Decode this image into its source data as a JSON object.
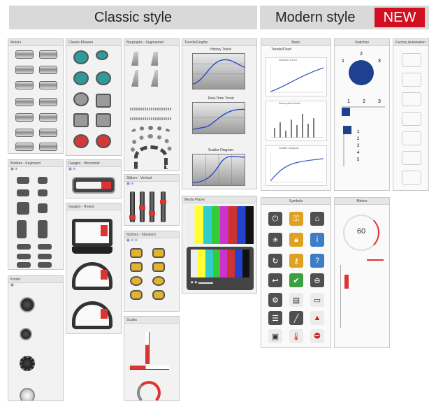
{
  "headers": {
    "classic": "Classic style",
    "modern": "Modern style",
    "new_badge": "NEW"
  },
  "panels": {
    "motors": "Motors",
    "blowers": "Classic Blowers",
    "bargraphs": "Bargraphs - Segmented",
    "trends": "Trends/Graphs",
    "buttons_keyboard": "Buttons - Keyboard",
    "gauges_horizontal": "Gauges - Horizontal",
    "gauges_round": "Gauges - Round",
    "sliders_vertical": "Sliders - Vertical",
    "buttons_standard": "Buttons - Standard",
    "knobs": "Knobs",
    "scales": "Scales",
    "media_player": "Media Player",
    "basic": "Basic",
    "trends_chart": "Trends/Chart",
    "switches": "Switches",
    "factory_automation": "Factory Automation",
    "symbols": "Symbols",
    "meters": "Meters"
  },
  "chart_titles": {
    "history": "History Trend",
    "realtime": "Real-Time Trend",
    "scatter": "Scatter Diagram",
    "modern_line": "Window Trend",
    "modern_bar": "Description Meter",
    "modern_scatter": "Scatter Diagram"
  },
  "meter_value": "60",
  "switch_labels": {
    "a": "1",
    "b": "2",
    "c": "3",
    "d": "1",
    "e": "2",
    "f": "3",
    "g": "1",
    "h": "2",
    "i": "3",
    "j": "4",
    "k": "5"
  }
}
